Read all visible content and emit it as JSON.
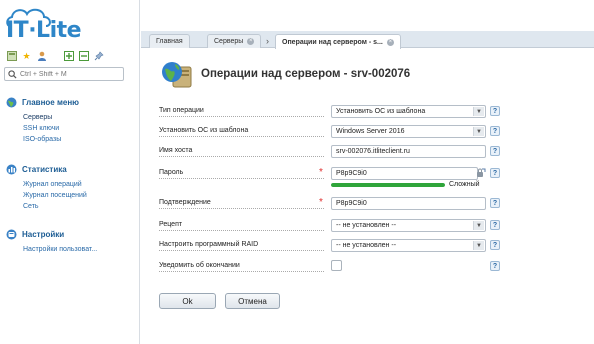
{
  "app": {
    "logo": "IT·Lite"
  },
  "sidebar": {
    "search_placeholder": "Ctrl + Shift + M",
    "groups": [
      {
        "title": "Главное меню",
        "items": [
          "Серверы",
          "SSH ключи",
          "ISO-образы"
        ]
      },
      {
        "title": "Статистика",
        "items": [
          "Журнал операций",
          "Журнал посещений",
          "Сеть"
        ]
      },
      {
        "title": "Настройки",
        "items": [
          "Настройки пользоват..."
        ]
      }
    ]
  },
  "tabs": [
    {
      "label": "Главная"
    },
    {
      "label": "Серверы"
    },
    {
      "label": "Операции над сервером - s..."
    }
  ],
  "page": {
    "title": "Операции над сервером - srv-002076"
  },
  "form": {
    "op_type": {
      "label": "Тип операции",
      "value": "Установить ОС из шаблона"
    },
    "os_template": {
      "label": "Установить ОС из шаблона",
      "value": "Windows Server 2016"
    },
    "hostname": {
      "label": "Имя хоста",
      "value": "srv-002076.itliteclient.ru"
    },
    "password": {
      "label": "Пароль",
      "value": "P8p9C9i0",
      "strength_label": "Сложный",
      "strength_fraction": 1.0
    },
    "confirm": {
      "label": "Подтверждение",
      "value": "P8p9C9i0"
    },
    "recipe": {
      "label": "Рецепт",
      "value": "-- не установлен --"
    },
    "raid": {
      "label": "Настроить программный RAID",
      "value": "-- не установлен --"
    },
    "notify": {
      "label": "Уведомить об окончании",
      "checked": false
    },
    "help_glyph": "?",
    "ok_label": "Ok",
    "cancel_label": "Отмена"
  },
  "colors": {
    "accent": "#2e86c8",
    "strength": "#2fa53a",
    "required": "#e03030"
  }
}
